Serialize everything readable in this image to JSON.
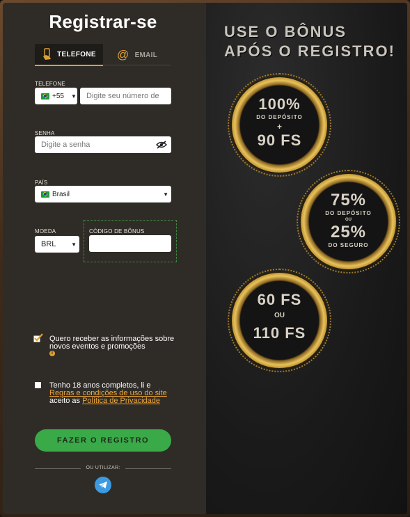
{
  "form": {
    "title": "Registrar-se",
    "tabs": [
      {
        "label": "TELEFONE",
        "icon": "phone-hand-icon",
        "active": true
      },
      {
        "label": "EMAIL",
        "icon": "at-icon",
        "active": false
      }
    ],
    "phone": {
      "label": "TELEFONE",
      "country_code": "+55",
      "placeholder": "Digite seu número de"
    },
    "password": {
      "label": "SENHA",
      "placeholder": "Digite a senha"
    },
    "country": {
      "label": "PAÍS",
      "value": "Brasil"
    },
    "currency": {
      "label": "MOEDA",
      "value": "BRL"
    },
    "bonus_code": {
      "label": "CÓDIGO DE BÔNUS",
      "value": ""
    },
    "newsletter": {
      "text": "Quero receber as informações sobre novos eventos e promoções",
      "checked": true
    },
    "terms": {
      "text_before": "Tenho 18 anos completos, li e",
      "link1": "Regras e condições de uso do site",
      "text_middle": "aceito as",
      "link2": "Política de Privacidade",
      "checked": false
    },
    "submit_label": "FAZER O REGISTRO",
    "or_label": "OU UTILIZAR:"
  },
  "promo": {
    "headline_line1": "USE O BÔNUS",
    "headline_line2": "APÓS O REGISTRO!",
    "coin1": {
      "big": "100%",
      "small": "DO DEPÓSITO",
      "plus": "+",
      "big2": "90 FS"
    },
    "coin2": {
      "big": "75%",
      "small": "DO DEPÓSITO",
      "or": "OU",
      "big2": "25%",
      "small2": "DO SEGURO"
    },
    "coin3": {
      "big": "60 FS",
      "or": "OU",
      "big2": "110 FS"
    }
  },
  "colors": {
    "accent_green": "#3aa948",
    "accent_orange": "#f0a63a",
    "gold": "#e8c25a"
  }
}
